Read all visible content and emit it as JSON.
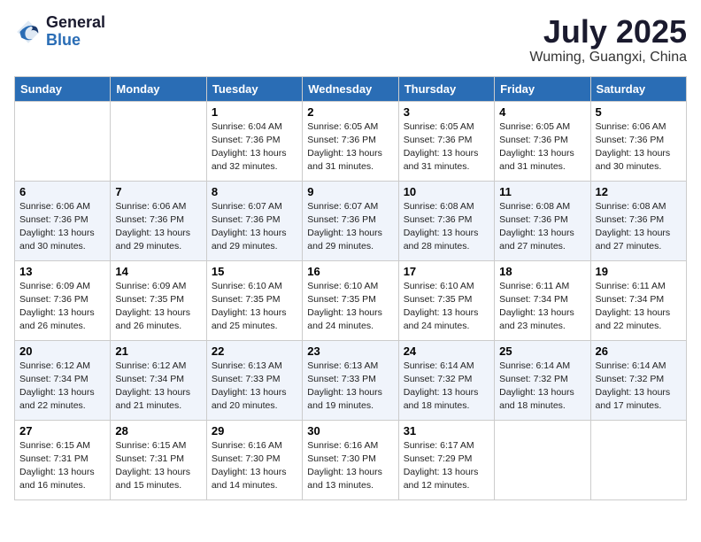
{
  "header": {
    "logo_general": "General",
    "logo_blue": "Blue",
    "month_title": "July 2025",
    "subtitle": "Wuming, Guangxi, China"
  },
  "days_of_week": [
    "Sunday",
    "Monday",
    "Tuesday",
    "Wednesday",
    "Thursday",
    "Friday",
    "Saturday"
  ],
  "weeks": [
    [
      {
        "num": "",
        "detail": ""
      },
      {
        "num": "",
        "detail": ""
      },
      {
        "num": "1",
        "detail": "Sunrise: 6:04 AM\nSunset: 7:36 PM\nDaylight: 13 hours and 32 minutes."
      },
      {
        "num": "2",
        "detail": "Sunrise: 6:05 AM\nSunset: 7:36 PM\nDaylight: 13 hours and 31 minutes."
      },
      {
        "num": "3",
        "detail": "Sunrise: 6:05 AM\nSunset: 7:36 PM\nDaylight: 13 hours and 31 minutes."
      },
      {
        "num": "4",
        "detail": "Sunrise: 6:05 AM\nSunset: 7:36 PM\nDaylight: 13 hours and 31 minutes."
      },
      {
        "num": "5",
        "detail": "Sunrise: 6:06 AM\nSunset: 7:36 PM\nDaylight: 13 hours and 30 minutes."
      }
    ],
    [
      {
        "num": "6",
        "detail": "Sunrise: 6:06 AM\nSunset: 7:36 PM\nDaylight: 13 hours and 30 minutes."
      },
      {
        "num": "7",
        "detail": "Sunrise: 6:06 AM\nSunset: 7:36 PM\nDaylight: 13 hours and 29 minutes."
      },
      {
        "num": "8",
        "detail": "Sunrise: 6:07 AM\nSunset: 7:36 PM\nDaylight: 13 hours and 29 minutes."
      },
      {
        "num": "9",
        "detail": "Sunrise: 6:07 AM\nSunset: 7:36 PM\nDaylight: 13 hours and 29 minutes."
      },
      {
        "num": "10",
        "detail": "Sunrise: 6:08 AM\nSunset: 7:36 PM\nDaylight: 13 hours and 28 minutes."
      },
      {
        "num": "11",
        "detail": "Sunrise: 6:08 AM\nSunset: 7:36 PM\nDaylight: 13 hours and 27 minutes."
      },
      {
        "num": "12",
        "detail": "Sunrise: 6:08 AM\nSunset: 7:36 PM\nDaylight: 13 hours and 27 minutes."
      }
    ],
    [
      {
        "num": "13",
        "detail": "Sunrise: 6:09 AM\nSunset: 7:36 PM\nDaylight: 13 hours and 26 minutes."
      },
      {
        "num": "14",
        "detail": "Sunrise: 6:09 AM\nSunset: 7:35 PM\nDaylight: 13 hours and 26 minutes."
      },
      {
        "num": "15",
        "detail": "Sunrise: 6:10 AM\nSunset: 7:35 PM\nDaylight: 13 hours and 25 minutes."
      },
      {
        "num": "16",
        "detail": "Sunrise: 6:10 AM\nSunset: 7:35 PM\nDaylight: 13 hours and 24 minutes."
      },
      {
        "num": "17",
        "detail": "Sunrise: 6:10 AM\nSunset: 7:35 PM\nDaylight: 13 hours and 24 minutes."
      },
      {
        "num": "18",
        "detail": "Sunrise: 6:11 AM\nSunset: 7:34 PM\nDaylight: 13 hours and 23 minutes."
      },
      {
        "num": "19",
        "detail": "Sunrise: 6:11 AM\nSunset: 7:34 PM\nDaylight: 13 hours and 22 minutes."
      }
    ],
    [
      {
        "num": "20",
        "detail": "Sunrise: 6:12 AM\nSunset: 7:34 PM\nDaylight: 13 hours and 22 minutes."
      },
      {
        "num": "21",
        "detail": "Sunrise: 6:12 AM\nSunset: 7:34 PM\nDaylight: 13 hours and 21 minutes."
      },
      {
        "num": "22",
        "detail": "Sunrise: 6:13 AM\nSunset: 7:33 PM\nDaylight: 13 hours and 20 minutes."
      },
      {
        "num": "23",
        "detail": "Sunrise: 6:13 AM\nSunset: 7:33 PM\nDaylight: 13 hours and 19 minutes."
      },
      {
        "num": "24",
        "detail": "Sunrise: 6:14 AM\nSunset: 7:32 PM\nDaylight: 13 hours and 18 minutes."
      },
      {
        "num": "25",
        "detail": "Sunrise: 6:14 AM\nSunset: 7:32 PM\nDaylight: 13 hours and 18 minutes."
      },
      {
        "num": "26",
        "detail": "Sunrise: 6:14 AM\nSunset: 7:32 PM\nDaylight: 13 hours and 17 minutes."
      }
    ],
    [
      {
        "num": "27",
        "detail": "Sunrise: 6:15 AM\nSunset: 7:31 PM\nDaylight: 13 hours and 16 minutes."
      },
      {
        "num": "28",
        "detail": "Sunrise: 6:15 AM\nSunset: 7:31 PM\nDaylight: 13 hours and 15 minutes."
      },
      {
        "num": "29",
        "detail": "Sunrise: 6:16 AM\nSunset: 7:30 PM\nDaylight: 13 hours and 14 minutes."
      },
      {
        "num": "30",
        "detail": "Sunrise: 6:16 AM\nSunset: 7:30 PM\nDaylight: 13 hours and 13 minutes."
      },
      {
        "num": "31",
        "detail": "Sunrise: 6:17 AM\nSunset: 7:29 PM\nDaylight: 13 hours and 12 minutes."
      },
      {
        "num": "",
        "detail": ""
      },
      {
        "num": "",
        "detail": ""
      }
    ]
  ]
}
